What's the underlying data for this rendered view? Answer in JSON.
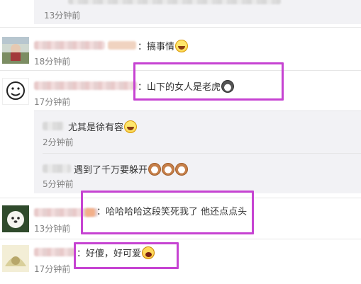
{
  "top": {
    "time": "13分钟前"
  },
  "comments": [
    {
      "text": "：搞事情",
      "emoji": "laugh-emoji",
      "time": "18分钟前"
    },
    {
      "text": "：山下的女人是老虎",
      "emoji": "husky-emoji",
      "time": "17分钟前"
    },
    {
      "text": "：哈哈哈哈这段笑死我了 他还点点头",
      "time": "13分钟前"
    },
    {
      "text": "：好傻，好可爱",
      "emoji": "cry-laugh-emoji",
      "time": "17分钟前"
    }
  ],
  "replies": [
    {
      "text": "尤其是徐有容",
      "emoji": "laugh-emoji",
      "time": "2分钟前"
    },
    {
      "text": "遇到了千万要躲开",
      "emoji": "dog-emoji",
      "time": "5分钟前"
    }
  ],
  "colors": {
    "highlight": "#c643d2",
    "reply_bg": "#f2f2f5",
    "time_text": "#808080"
  }
}
